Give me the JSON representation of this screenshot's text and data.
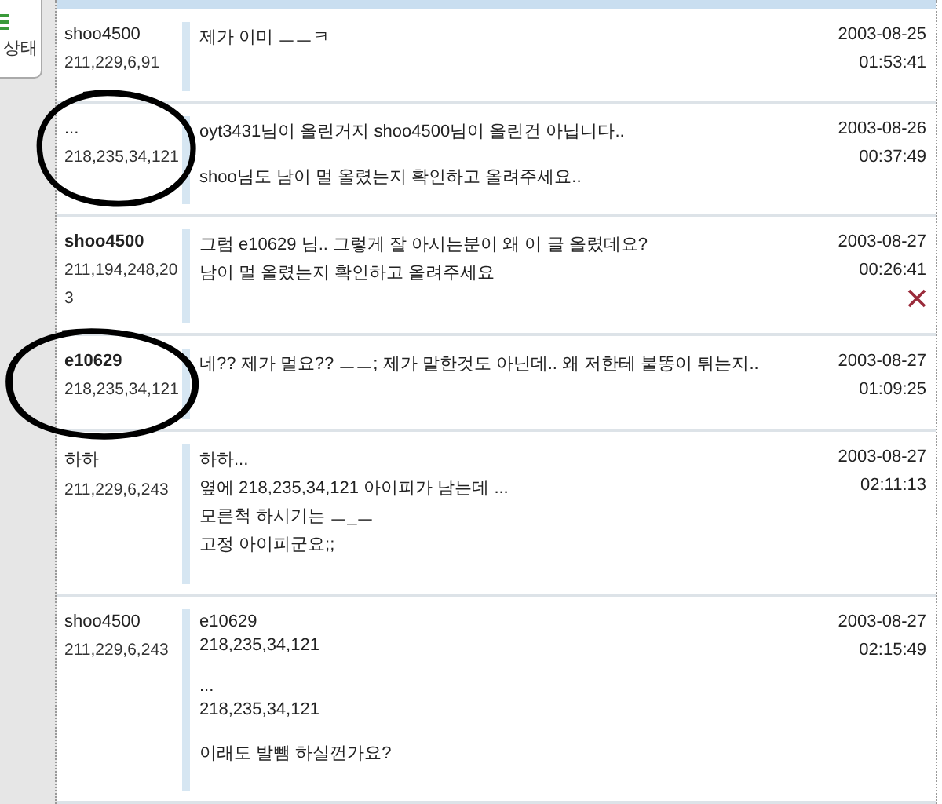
{
  "side_button": {
    "label": "상태"
  },
  "comments": [
    {
      "author": "shoo4500",
      "ip": "211,229,6,91",
      "bold": false,
      "circled": false,
      "deletable": false,
      "paragraphs": [
        [
          "제가 이미 ㅡㅡㅋ"
        ]
      ],
      "date": "2003-08-25",
      "time": "01:53:41"
    },
    {
      "author": "...",
      "ip": "218,235,34,121",
      "bold": false,
      "circled": true,
      "deletable": false,
      "paragraphs": [
        [
          "oyt3431님이 올린거지 shoo4500님이 올린건 아닙니다.."
        ],
        [
          "shoo님도 남이 멀 올렸는지 확인하고 올려주세요.."
        ]
      ],
      "date": "2003-08-26",
      "time": "00:37:49"
    },
    {
      "author": "shoo4500",
      "ip": "211,194,248,203",
      "bold": true,
      "circled": false,
      "deletable": true,
      "paragraphs": [
        [
          "그럼 e10629 님.. 그렇게 잘 아시는분이 왜 이 글 올렸데요?",
          "남이 멀 올렸는지 확인하고 올려주세요"
        ]
      ],
      "date": "2003-08-27",
      "time": "00:26:41"
    },
    {
      "author": "e10629",
      "ip": "218,235,34,121",
      "bold": true,
      "circled": true,
      "deletable": false,
      "paragraphs": [
        [
          "네?? 제가 멀요?? ㅡㅡ; 제가 말한것도 아닌데.. 왜 저한테 불똥이 튀는지.."
        ]
      ],
      "date": "2003-08-27",
      "time": "01:09:25"
    },
    {
      "author": "하하",
      "ip": "211,229,6,243",
      "bold": false,
      "circled": false,
      "deletable": false,
      "paragraphs": [
        [
          "하하...",
          "옆에 218,235,34,121 아이피가 남는데 ...",
          "모른척 하시기는 ㅡ_ㅡ",
          "고정 아이피군요;;"
        ]
      ],
      "date": "2003-08-27",
      "time": "02:11:13"
    },
    {
      "author": "shoo4500",
      "ip": "211,229,6,243",
      "bold": false,
      "circled": false,
      "deletable": false,
      "paragraphs": [
        [
          "e10629",
          "218,235,34,121"
        ],
        [
          "...",
          "218,235,34,121"
        ],
        [
          "이래도 발뺌 하실껀가요?"
        ]
      ],
      "date": "2003-08-27",
      "time": "02:15:49"
    }
  ]
}
